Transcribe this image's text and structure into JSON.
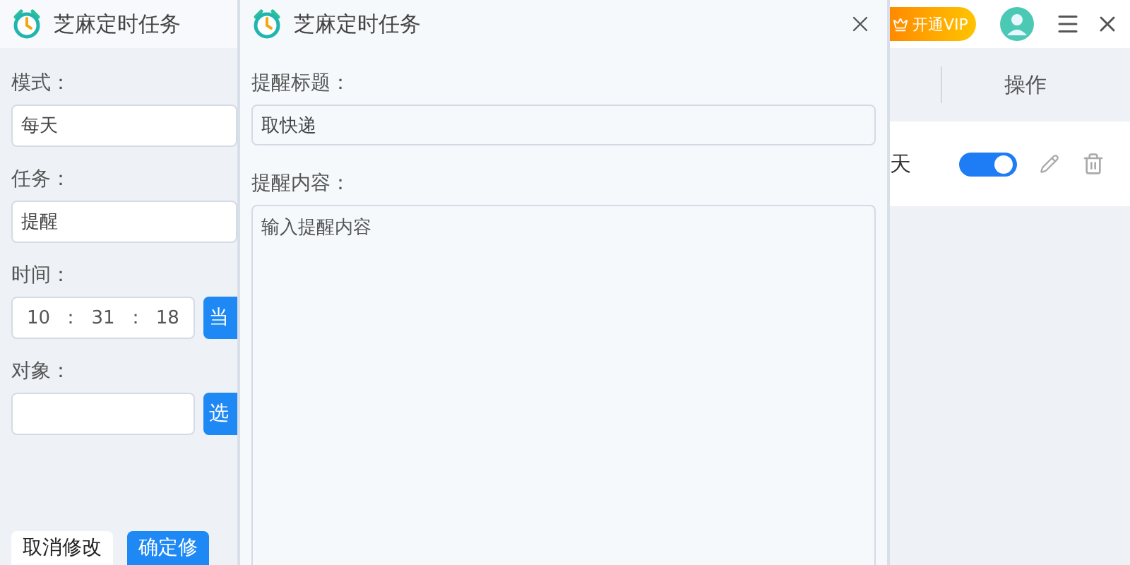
{
  "main_window": {
    "title": "芝麻定时任务",
    "vip_button": "开通VIP",
    "form": [
      {
        "kind": "text",
        "label": "模式：",
        "value": "每天"
      },
      {
        "kind": "text",
        "label": "任务：",
        "value": "提醒"
      },
      {
        "kind": "time",
        "label": "时间：",
        "hour": "10",
        "minute": "31",
        "second": "18",
        "separator": "：",
        "button": "当"
      },
      {
        "kind": "text",
        "label": "对象：",
        "button": "选"
      }
    ],
    "actions": [
      {
        "label": "取消修改",
        "primary": false
      },
      {
        "label": "确定修",
        "primary": true
      }
    ],
    "table": {
      "columns": [
        {
          "label": "操作"
        }
      ],
      "rows": [
        {
          "cell_1": "天",
          "enabled": true
        }
      ]
    }
  },
  "dialog": {
    "title": "芝麻定时任务",
    "fields": [
      {
        "kind": "input",
        "label": "提醒标题：",
        "value": "取快递"
      },
      {
        "kind": "textarea",
        "label": "提醒内容：",
        "placeholder": "输入提醒内容"
      }
    ]
  }
}
